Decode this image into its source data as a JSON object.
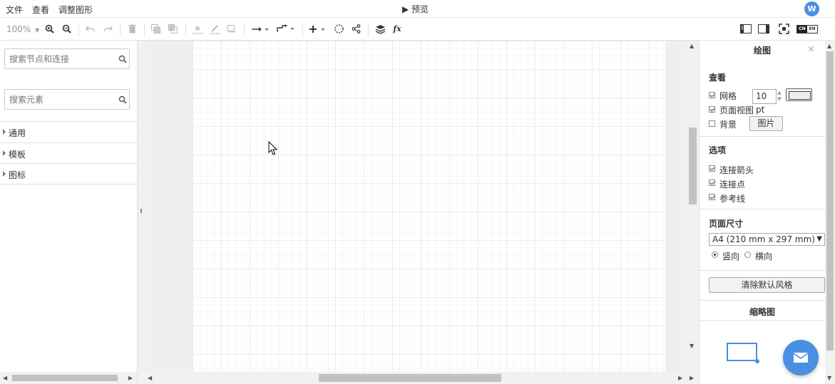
{
  "menubar": {
    "items": [
      "文件",
      "查看",
      "调整图形"
    ],
    "preview": "▶ 预览",
    "avatar_letter": "W"
  },
  "toolbar": {
    "zoom": "100%",
    "icons": [
      "zoom-in-icon",
      "zoom-out-icon",
      "undo-icon",
      "redo-icon",
      "delete-icon",
      "to-front-icon",
      "to-back-icon",
      "fill-color-icon",
      "line-color-icon",
      "shadow-icon",
      "connection-icon",
      "waypoints-icon",
      "insert-icon",
      "collapse-icon",
      "share-icon",
      "layers-icon",
      "formula-icon",
      "format-panel-icon",
      "outline-panel-icon",
      "fullscreen-icon",
      "language-toggle-icon"
    ],
    "language": {
      "left": "CN",
      "right": "EN"
    }
  },
  "left_panel": {
    "search_shapes_placeholder": "搜索节点和连接",
    "search_elements_placeholder": "搜索元素",
    "libraries": [
      "通用",
      "模板",
      "图标"
    ]
  },
  "right_panel": {
    "title": "绘图",
    "close": "×",
    "view": {
      "heading": "查看",
      "grid_label": "网格",
      "grid_checked": true,
      "grid_size": "10 pt",
      "page_view_label": "页面视图",
      "page_view_checked": true,
      "background_label": "背景",
      "background_checked": false,
      "image_button": "图片"
    },
    "options": {
      "heading": "选项",
      "items": [
        {
          "label": "连接箭头",
          "checked": true
        },
        {
          "label": "连接点",
          "checked": true
        },
        {
          "label": "参考线",
          "checked": true
        }
      ]
    },
    "page_size": {
      "heading": "页面尺寸",
      "selected": "A4 (210 mm x 297 mm)",
      "orientation": [
        {
          "label": "竖向",
          "selected": true
        },
        {
          "label": "横向",
          "selected": false
        }
      ]
    },
    "clear_style_button": "清除默认风格",
    "outline_title": "缩略图"
  },
  "colors": {
    "accent": "#4a90e2",
    "border": "#e0e0e0",
    "canvas_bg": "#efefef"
  }
}
